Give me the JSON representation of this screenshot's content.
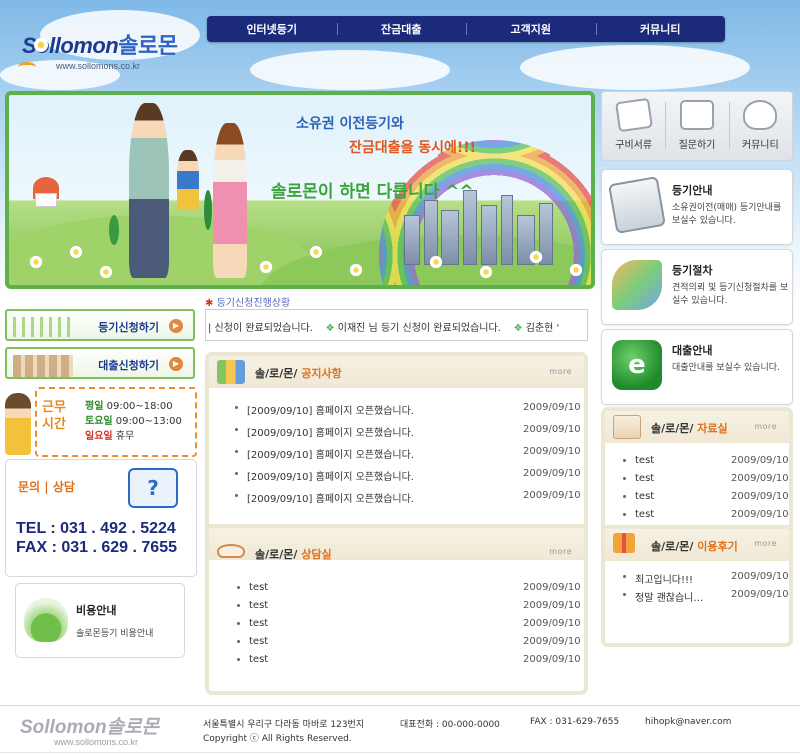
{
  "logo": {
    "latin": "Sollomon",
    "korean": "솔로몬",
    "url": "www.sollomons.co.kr"
  },
  "topnav": [
    "인터넷등기",
    "잔금대출",
    "고객지원",
    "커뮤니티"
  ],
  "banner": {
    "line1": "소유권 이전등기와",
    "line2": "잔금대출을 동시에!!!",
    "line3": "솔로몬이 하면 다릅니다 ^^"
  },
  "quick_icons": [
    {
      "label": "구비서류",
      "icon": "document-pen-icon"
    },
    {
      "label": "질문하기",
      "icon": "question-speaker-icon"
    },
    {
      "label": "커뮤니티",
      "icon": "hands-sprout-icon"
    }
  ],
  "info_boxes": [
    {
      "title": "등기안내",
      "desc": "소유권이전(매매) 등기안내를 보실수 있습니다.",
      "icon": "computer-icon"
    },
    {
      "title": "등기절차",
      "desc": "견적의뢰 및 등기신청절차를 보실수 있습니다.",
      "icon": "procedure-icon"
    },
    {
      "title": "대출안내",
      "desc": "대출안내를 보실수 있습니다.",
      "icon": "e-icon"
    }
  ],
  "left_buttons": [
    {
      "label": "등기신청하기",
      "icon": "sprouts-icon"
    },
    {
      "label": "대출신청하기",
      "icon": "buildings-icon"
    }
  ],
  "hours": {
    "tag": "근무 시간",
    "rows": [
      {
        "key": "평일",
        "value": "09:00~18:00",
        "color": "#2e8b2e"
      },
      {
        "key": "토요일",
        "value": "09:00~13:00",
        "color": "#2e8b2e"
      },
      {
        "key": "일요일",
        "value": "휴무",
        "color": "#d9342b"
      }
    ]
  },
  "contact": {
    "title": "문의 | 상담",
    "tel": "TEL : 031 . 492 . 5224",
    "fax": "FAX : 031 . 629 . 7655"
  },
  "cost": {
    "title": "비용안내",
    "desc": "솔로몬등기 비용안내"
  },
  "ticker": {
    "label": "등기신청진행상황",
    "text_a": "| 신청이 완료되었습니다.",
    "text_b": "이재진 님 등기 신청이 완료되었습니다.",
    "text_c": "김춘현 '"
  },
  "notice": {
    "title_prefix": "솔/로/몬/",
    "title": "공지사항",
    "more": "more",
    "items": [
      {
        "text": "[2009/09/10] 홈페이지 오픈했습니다.",
        "date": "2009/09/10"
      },
      {
        "text": "[2009/09/10] 홈페이지 오픈했습니다.",
        "date": "2009/09/10"
      },
      {
        "text": "[2009/09/10] 홈페이지 오픈했습니다.",
        "date": "2009/09/10"
      },
      {
        "text": "[2009/09/10] 홈페이지 오픈했습니다.",
        "date": "2009/09/10"
      },
      {
        "text": "[2009/09/10] 홈페이지 오픈했습니다.",
        "date": "2009/09/10"
      }
    ]
  },
  "consult": {
    "title_prefix": "솔/로/몬/",
    "title": "상담실",
    "more": "more",
    "items": [
      {
        "text": "test",
        "date": "2009/09/10"
      },
      {
        "text": "test",
        "date": "2009/09/10"
      },
      {
        "text": "test",
        "date": "2009/09/10"
      },
      {
        "text": "test",
        "date": "2009/09/10"
      },
      {
        "text": "test",
        "date": "2009/09/10"
      }
    ]
  },
  "archive": {
    "title_prefix": "솔/로/몬/",
    "title": "자료실",
    "more": "more",
    "items": [
      {
        "text": "test",
        "date": "2009/09/10"
      },
      {
        "text": "test",
        "date": "2009/09/10"
      },
      {
        "text": "test",
        "date": "2009/09/10"
      },
      {
        "text": "test",
        "date": "2009/09/10"
      }
    ]
  },
  "reviews": {
    "title_prefix": "솔/로/몬/",
    "title": "이용후기",
    "more": "more",
    "items": [
      {
        "text": "최고입니다!!!",
        "date": "2009/09/10"
      },
      {
        "text": "정말 괜찮습니…",
        "date": "2009/09/10"
      }
    ]
  },
  "footer": {
    "logo_latin": "Sollomon",
    "logo_korean": "솔로몬",
    "url": "www.sollomons.co.kr",
    "address": "서울특별시 우리구 다라동 마바로 123번지",
    "copyright": "Copyright ⓒ All Rights Reserved.",
    "phone": "대표전화 : 00-000-0000",
    "fax": "FAX : 031-629-7655",
    "email": "hihopk@naver.com"
  },
  "colors": {
    "nav_bg": "#1b2a7a",
    "banner_border": "#5db04a",
    "accent_orange": "#e0701c",
    "panel_border": "#ece6d4"
  }
}
